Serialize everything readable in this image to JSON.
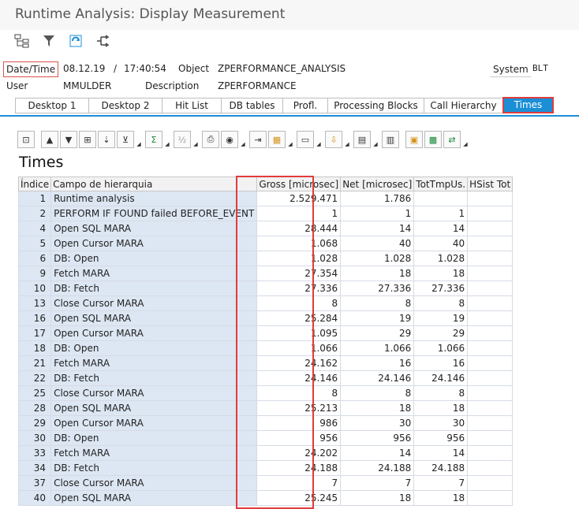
{
  "window": {
    "title": "Runtime Analysis: Display Measurement"
  },
  "toolbar": {
    "icons": [
      "hierarchy-icon",
      "filter-icon",
      "refresh-icon",
      "split-icon"
    ]
  },
  "header": {
    "datetime_label": "Date/Time",
    "date": "08.12.19",
    "time_sep": "/",
    "time": "17:40:54",
    "object_label": "Object",
    "object": "ZPERFORMANCE_ANALYSIS",
    "system_label": "System",
    "system": "BLT",
    "user_label": "User",
    "user": "MMULDER",
    "description_label": "Description",
    "description": "ZPERFORMANCE"
  },
  "tabs": [
    {
      "label": "Desktop 1"
    },
    {
      "label": "Desktop 2"
    },
    {
      "label": "Hit List"
    },
    {
      "label": "DB tables"
    },
    {
      "label": "Profl."
    },
    {
      "label": "Processing Blocks"
    },
    {
      "label": "Call Hierarchy"
    },
    {
      "label": "Times",
      "active": true
    }
  ],
  "grid": {
    "title": "Times",
    "columns": [
      "Índice",
      "Campo de hierarquia",
      "Gross [microsec]",
      "Net [microsec]",
      "TotTmpUs.",
      "HSist Tot"
    ],
    "rows": [
      [
        "1",
        "Runtime analysis",
        "2.529.471",
        "1.786",
        "",
        ""
      ],
      [
        "2",
        "PERFORM IF FOUND failed BEFORE_EVENT",
        "1",
        "1",
        "1",
        ""
      ],
      [
        "4",
        "Open SQL MARA",
        "28.444",
        "14",
        "14",
        ""
      ],
      [
        "5",
        "Open Cursor MARA",
        "1.068",
        "40",
        "40",
        ""
      ],
      [
        "6",
        "DB: Open",
        "1.028",
        "1.028",
        "1.028",
        ""
      ],
      [
        "9",
        "Fetch MARA",
        "27.354",
        "18",
        "18",
        ""
      ],
      [
        "10",
        "DB: Fetch",
        "27.336",
        "27.336",
        "27.336",
        ""
      ],
      [
        "13",
        "Close Cursor MARA",
        "8",
        "8",
        "8",
        ""
      ],
      [
        "16",
        "Open SQL MARA",
        "25.284",
        "19",
        "19",
        ""
      ],
      [
        "17",
        "Open Cursor MARA",
        "1.095",
        "29",
        "29",
        ""
      ],
      [
        "18",
        "DB: Open",
        "1.066",
        "1.066",
        "1.066",
        ""
      ],
      [
        "21",
        "Fetch MARA",
        "24.162",
        "16",
        "16",
        ""
      ],
      [
        "22",
        "DB: Fetch",
        "24.146",
        "24.146",
        "24.146",
        ""
      ],
      [
        "25",
        "Close Cursor MARA",
        "8",
        "8",
        "8",
        ""
      ],
      [
        "28",
        "Open SQL MARA",
        "25.213",
        "18",
        "18",
        ""
      ],
      [
        "29",
        "Open Cursor MARA",
        "986",
        "30",
        "30",
        ""
      ],
      [
        "30",
        "DB: Open",
        "956",
        "956",
        "956",
        ""
      ],
      [
        "33",
        "Fetch MARA",
        "24.202",
        "14",
        "14",
        ""
      ],
      [
        "34",
        "DB: Fetch",
        "24.188",
        "24.188",
        "24.188",
        ""
      ],
      [
        "37",
        "Close Cursor MARA",
        "7",
        "7",
        "7",
        ""
      ],
      [
        "40",
        "Open SQL MARA",
        "25.245",
        "18",
        "18",
        ""
      ]
    ]
  },
  "colors": {
    "accent": "#1b8fd6",
    "highlight": "#e03c3c",
    "key_cell": "#dde7f3"
  }
}
